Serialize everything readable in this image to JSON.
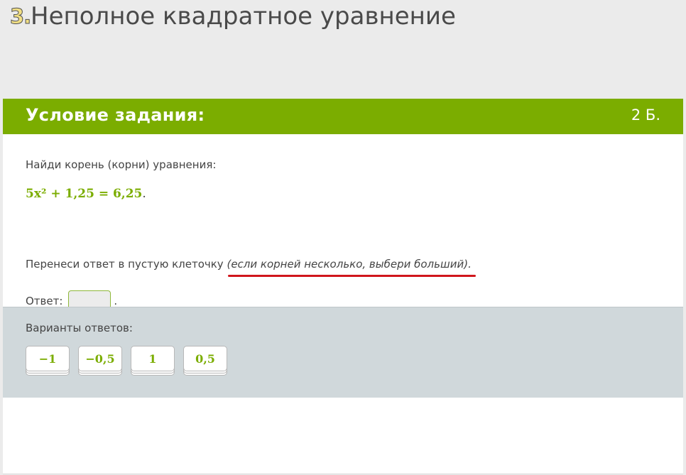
{
  "header": {
    "task_number": "3.",
    "title": "Неполное квадратное уравнение"
  },
  "card": {
    "header_title": "Условие задания:",
    "points": "2 Б.",
    "instruction": "Найди корень (корни) уравнения:",
    "equation": "5x² + 1,25 = 6,25",
    "equation_period": ".",
    "hint_text": "Перенеси ответ в пустую клеточку ",
    "hint_note": "(если корней несколько, выбери больший).",
    "answer_label": "Ответ:",
    "answer_dot": "."
  },
  "variants": {
    "label": "Варианты ответов:",
    "options": [
      "−1",
      "−0,5",
      "1",
      "0,5"
    ]
  },
  "colors": {
    "accent": "#7bad00",
    "underline": "#d0161c",
    "variants_bg": "#d0d8db"
  }
}
